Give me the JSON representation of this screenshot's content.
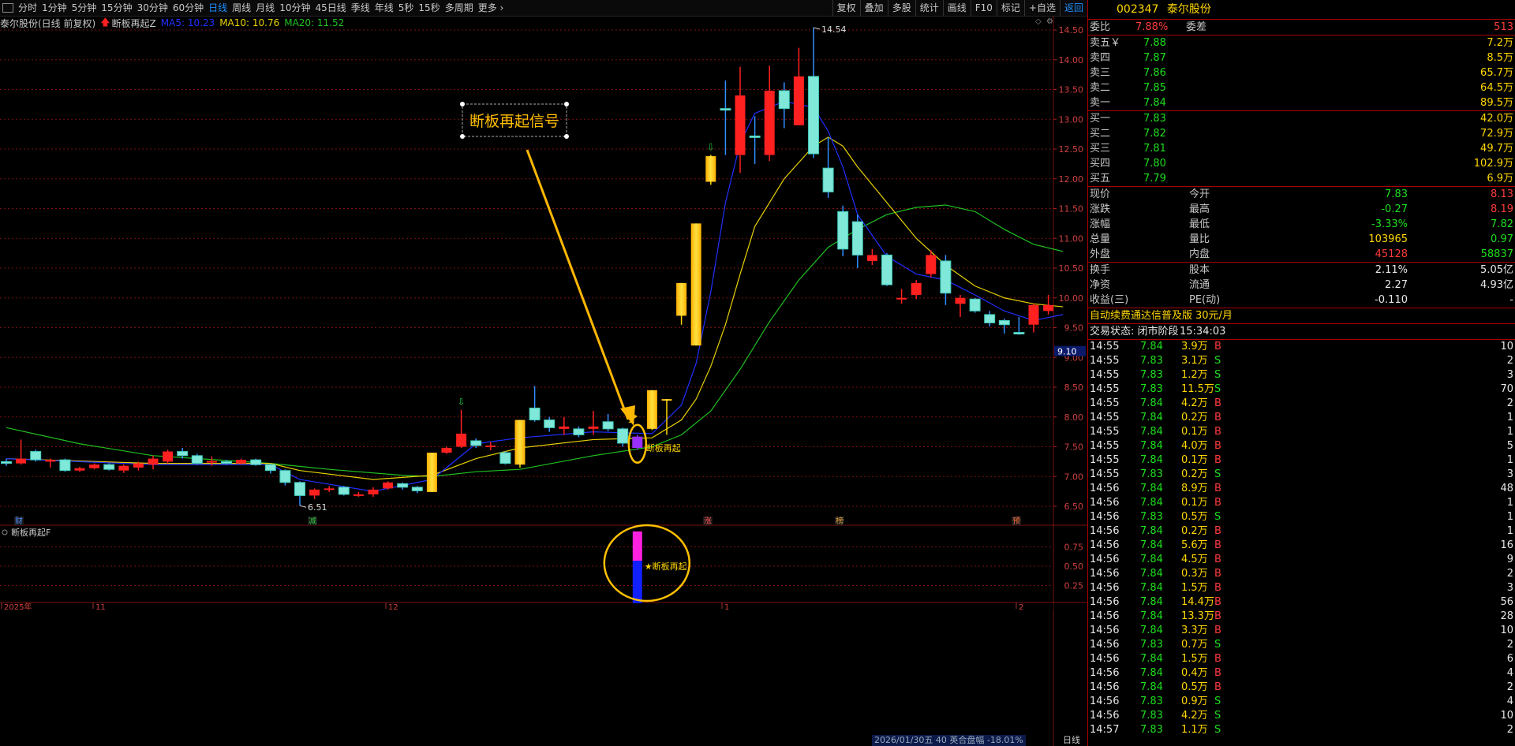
{
  "toolbar": {
    "periods": [
      "分时",
      "1分钟",
      "5分钟",
      "15分钟",
      "30分钟",
      "60分钟",
      "日线",
      "周线",
      "月线",
      "10分钟",
      "45日线",
      "季线",
      "年线",
      "5秒",
      "15秒",
      "多周期",
      "更多 ›"
    ],
    "active_period": "日线",
    "right_buttons": [
      "复权",
      "叠加",
      "多股",
      "统计",
      "画线",
      "F10",
      "标记",
      "+自选",
      "返回"
    ],
    "highlight_button": "返回"
  },
  "info": {
    "stock_label": "泰尔股份(日线 前复权)",
    "indicator_name": "断板再起Z",
    "ma5": "MA5: 10.23",
    "ma10": "MA10: 10.76",
    "ma20": "MA20: 11.52"
  },
  "colors": {
    "up": "#ff2020",
    "down": "#48d8c8",
    "signal": "#ffd700",
    "ma5": "#2030ff",
    "ma10": "#e6d000",
    "ma20": "#20c020",
    "grid": "#7a1010"
  },
  "chart_data": {
    "type": "candlestick",
    "price_axis": {
      "ticks": [
        6.5,
        7.0,
        7.5,
        8.0,
        8.5,
        9.0,
        9.5,
        10.0,
        10.5,
        11.0,
        11.5,
        12.0,
        12.5,
        13.0,
        13.5,
        14.0,
        14.5
      ],
      "range": [
        6.3,
        14.7
      ]
    },
    "annotations": {
      "high": "14.54",
      "low": "6.51",
      "crosshair_price": "9.10",
      "signal_label": "断板再起",
      "box_label": "断板再起信号"
    },
    "date_labels": [
      "2025年",
      "11",
      "12",
      "1",
      "2"
    ],
    "event_markers": [
      "财",
      "减",
      "涨",
      "榜",
      "预"
    ],
    "candles": [
      {
        "o": 7.25,
        "c": 7.22,
        "h": 7.3,
        "l": 7.18,
        "t": "down"
      },
      {
        "o": 7.22,
        "c": 7.3,
        "h": 7.62,
        "l": 7.2,
        "t": "up"
      },
      {
        "o": 7.42,
        "c": 7.28,
        "h": 7.45,
        "l": 7.25,
        "t": "down"
      },
      {
        "o": 7.25,
        "c": 7.28,
        "h": 7.3,
        "l": 7.15,
        "t": "up"
      },
      {
        "o": 7.28,
        "c": 7.1,
        "h": 7.3,
        "l": 7.08,
        "t": "down"
      },
      {
        "o": 7.1,
        "c": 7.14,
        "h": 7.16,
        "l": 7.08,
        "t": "up"
      },
      {
        "o": 7.14,
        "c": 7.2,
        "h": 7.22,
        "l": 7.12,
        "t": "up"
      },
      {
        "o": 7.2,
        "c": 7.12,
        "h": 7.22,
        "l": 7.1,
        "t": "down"
      },
      {
        "o": 7.1,
        "c": 7.18,
        "h": 7.2,
        "l": 7.06,
        "t": "up"
      },
      {
        "o": 7.15,
        "c": 7.22,
        "h": 7.25,
        "l": 7.1,
        "t": "up"
      },
      {
        "o": 7.2,
        "c": 7.3,
        "h": 7.35,
        "l": 7.12,
        "t": "up"
      },
      {
        "o": 7.25,
        "c": 7.42,
        "h": 7.45,
        "l": 7.22,
        "t": "up"
      },
      {
        "o": 7.42,
        "c": 7.35,
        "h": 7.48,
        "l": 7.3,
        "t": "down"
      },
      {
        "o": 7.35,
        "c": 7.22,
        "h": 7.38,
        "l": 7.2,
        "t": "down"
      },
      {
        "o": 7.26,
        "c": 7.26,
        "h": 7.34,
        "l": 7.18,
        "t": "up"
      },
      {
        "o": 7.25,
        "c": 7.22,
        "h": 7.28,
        "l": 7.2,
        "t": "down"
      },
      {
        "o": 7.22,
        "c": 7.28,
        "h": 7.3,
        "l": 7.2,
        "t": "up"
      },
      {
        "o": 7.28,
        "c": 7.2,
        "h": 7.3,
        "l": 7.18,
        "t": "down"
      },
      {
        "o": 7.2,
        "c": 7.1,
        "h": 7.22,
        "l": 7.05,
        "t": "down"
      },
      {
        "o": 7.1,
        "c": 6.9,
        "h": 7.12,
        "l": 6.85,
        "t": "down"
      },
      {
        "o": 6.9,
        "c": 6.68,
        "h": 6.92,
        "l": 6.51,
        "t": "down"
      },
      {
        "o": 6.68,
        "c": 6.78,
        "h": 6.8,
        "l": 6.62,
        "t": "up"
      },
      {
        "o": 6.8,
        "c": 6.8,
        "h": 6.84,
        "l": 6.74,
        "t": "up"
      },
      {
        "o": 6.82,
        "c": 6.7,
        "h": 6.84,
        "l": 6.68,
        "t": "down"
      },
      {
        "o": 6.7,
        "c": 6.7,
        "h": 6.74,
        "l": 6.66,
        "t": "up"
      },
      {
        "o": 6.7,
        "c": 6.78,
        "h": 6.82,
        "l": 6.66,
        "t": "up"
      },
      {
        "o": 6.8,
        "c": 6.9,
        "h": 6.92,
        "l": 6.78,
        "t": "up"
      },
      {
        "o": 6.88,
        "c": 6.82,
        "h": 6.9,
        "l": 6.78,
        "t": "down"
      },
      {
        "o": 6.82,
        "c": 6.76,
        "h": 6.84,
        "l": 6.72,
        "t": "down"
      },
      {
        "o": 6.74,
        "c": 7.4,
        "h": 7.4,
        "l": 6.74,
        "t": "signal"
      },
      {
        "o": 7.4,
        "c": 7.48,
        "h": 7.5,
        "l": 7.38,
        "t": "up"
      },
      {
        "o": 7.5,
        "c": 7.72,
        "h": 8.12,
        "l": 7.48,
        "t": "up"
      },
      {
        "o": 7.6,
        "c": 7.52,
        "h": 7.64,
        "l": 7.48,
        "t": "down"
      },
      {
        "o": 7.52,
        "c": 7.52,
        "h": 7.58,
        "l": 7.44,
        "t": "up"
      },
      {
        "o": 7.4,
        "c": 7.22,
        "h": 7.42,
        "l": 7.2,
        "t": "down"
      },
      {
        "o": 7.2,
        "c": 7.95,
        "h": 7.95,
        "l": 7.15,
        "t": "signal"
      },
      {
        "o": 8.15,
        "c": 7.95,
        "h": 8.52,
        "l": 7.92,
        "t": "down"
      },
      {
        "o": 7.95,
        "c": 7.82,
        "h": 8.0,
        "l": 7.75,
        "t": "down"
      },
      {
        "o": 7.8,
        "c": 7.84,
        "h": 8.0,
        "l": 7.7,
        "t": "up"
      },
      {
        "o": 7.8,
        "c": 7.7,
        "h": 7.84,
        "l": 7.66,
        "t": "down"
      },
      {
        "o": 7.8,
        "c": 7.84,
        "h": 8.1,
        "l": 7.7,
        "t": "up"
      },
      {
        "o": 7.92,
        "c": 7.8,
        "h": 8.05,
        "l": 7.76,
        "t": "down"
      },
      {
        "o": 7.8,
        "c": 7.56,
        "h": 7.82,
        "l": 7.5,
        "t": "down"
      },
      {
        "o": 7.48,
        "c": 7.67,
        "h": 7.7,
        "l": 7.45,
        "t": "purple"
      },
      {
        "o": 7.8,
        "c": 8.45,
        "h": 8.45,
        "l": 7.78,
        "t": "signal"
      },
      {
        "o": 8.3,
        "c": 8.3,
        "h": 8.3,
        "l": 7.7,
        "t": "signal"
      },
      {
        "o": 9.7,
        "c": 10.25,
        "h": 10.25,
        "l": 9.55,
        "t": "signal"
      },
      {
        "o": 9.2,
        "c": 11.25,
        "h": 11.25,
        "l": 9.2,
        "t": "signal"
      },
      {
        "o": 11.95,
        "c": 12.38,
        "h": 12.4,
        "l": 11.9,
        "t": "signal"
      },
      {
        "o": 13.18,
        "c": 13.18,
        "h": 13.65,
        "l": 12.4,
        "t": "down"
      },
      {
        "o": 12.4,
        "c": 13.4,
        "h": 13.88,
        "l": 12.1,
        "t": "up"
      },
      {
        "o": 12.72,
        "c": 12.72,
        "h": 13.05,
        "l": 12.25,
        "t": "down"
      },
      {
        "o": 12.4,
        "c": 13.48,
        "h": 13.9,
        "l": 12.3,
        "t": "up"
      },
      {
        "o": 13.48,
        "c": 13.18,
        "h": 13.62,
        "l": 12.85,
        "t": "down"
      },
      {
        "o": 12.9,
        "c": 13.72,
        "h": 14.2,
        "l": 12.9,
        "t": "up"
      },
      {
        "o": 13.72,
        "c": 12.42,
        "h": 14.54,
        "l": 12.35,
        "t": "down"
      },
      {
        "o": 12.18,
        "c": 11.78,
        "h": 12.7,
        "l": 11.68,
        "t": "down"
      },
      {
        "o": 11.45,
        "c": 10.82,
        "h": 11.55,
        "l": 10.7,
        "t": "down"
      },
      {
        "o": 11.28,
        "c": 10.72,
        "h": 11.4,
        "l": 10.5,
        "t": "down"
      },
      {
        "o": 10.62,
        "c": 10.72,
        "h": 10.82,
        "l": 10.55,
        "t": "up"
      },
      {
        "o": 10.72,
        "c": 10.22,
        "h": 10.75,
        "l": 10.2,
        "t": "down"
      },
      {
        "o": 10.0,
        "c": 10.0,
        "h": 10.15,
        "l": 9.9,
        "t": "up"
      },
      {
        "o": 10.05,
        "c": 10.25,
        "h": 10.3,
        "l": 9.98,
        "t": "up"
      },
      {
        "o": 10.4,
        "c": 10.72,
        "h": 10.8,
        "l": 10.35,
        "t": "up"
      },
      {
        "o": 10.62,
        "c": 10.08,
        "h": 10.72,
        "l": 9.88,
        "t": "down"
      },
      {
        "o": 9.9,
        "c": 10.0,
        "h": 10.05,
        "l": 9.68,
        "t": "up"
      },
      {
        "o": 9.98,
        "c": 9.78,
        "h": 10.0,
        "l": 9.75,
        "t": "down"
      },
      {
        "o": 9.72,
        "c": 9.58,
        "h": 9.78,
        "l": 9.52,
        "t": "down"
      },
      {
        "o": 9.62,
        "c": 9.55,
        "h": 9.65,
        "l": 9.4,
        "t": "down"
      },
      {
        "o": 9.42,
        "c": 9.42,
        "h": 9.68,
        "l": 9.38,
        "t": "down"
      },
      {
        "o": 9.55,
        "c": 9.88,
        "h": 9.9,
        "l": 9.42,
        "t": "up"
      },
      {
        "o": 9.78,
        "c": 9.88,
        "h": 10.05,
        "l": 9.72,
        "t": "up"
      }
    ],
    "ma5": [
      [
        0,
        7.3
      ],
      [
        10,
        7.2
      ],
      [
        18,
        7.2
      ],
      [
        20,
        6.95
      ],
      [
        25,
        6.75
      ],
      [
        29,
        6.95
      ],
      [
        32,
        7.55
      ],
      [
        35,
        7.65
      ],
      [
        40,
        7.75
      ],
      [
        44,
        7.72
      ],
      [
        46,
        8.2
      ],
      [
        47,
        8.9
      ],
      [
        48,
        10.1
      ],
      [
        49,
        11.6
      ],
      [
        50,
        12.6
      ],
      [
        51,
        13.1
      ],
      [
        53,
        13.3
      ],
      [
        55,
        13.2
      ],
      [
        56,
        12.8
      ],
      [
        57,
        12.2
      ],
      [
        58,
        11.4
      ],
      [
        60,
        10.7
      ],
      [
        62,
        10.4
      ],
      [
        64,
        10.3
      ],
      [
        66,
        10.05
      ],
      [
        68,
        9.78
      ],
      [
        70,
        9.62
      ],
      [
        72,
        9.72
      ]
    ],
    "ma10": [
      [
        0,
        7.3
      ],
      [
        10,
        7.22
      ],
      [
        18,
        7.22
      ],
      [
        20,
        7.1
      ],
      [
        25,
        6.95
      ],
      [
        29,
        7.02
      ],
      [
        32,
        7.3
      ],
      [
        35,
        7.48
      ],
      [
        40,
        7.62
      ],
      [
        44,
        7.65
      ],
      [
        46,
        7.95
      ],
      [
        47,
        8.3
      ],
      [
        48,
        8.85
      ],
      [
        49,
        9.55
      ],
      [
        50,
        10.4
      ],
      [
        51,
        11.2
      ],
      [
        53,
        12.0
      ],
      [
        55,
        12.55
      ],
      [
        56,
        12.7
      ],
      [
        57,
        12.55
      ],
      [
        58,
        12.2
      ],
      [
        60,
        11.6
      ],
      [
        62,
        11.0
      ],
      [
        64,
        10.55
      ],
      [
        66,
        10.2
      ],
      [
        68,
        10.0
      ],
      [
        70,
        9.9
      ],
      [
        72,
        9.85
      ]
    ],
    "ma20": [
      [
        0,
        7.82
      ],
      [
        5,
        7.55
      ],
      [
        10,
        7.35
      ],
      [
        18,
        7.22
      ],
      [
        22,
        7.12
      ],
      [
        27,
        7.02
      ],
      [
        29,
        7.0
      ],
      [
        32,
        7.08
      ],
      [
        35,
        7.12
      ],
      [
        40,
        7.35
      ],
      [
        44,
        7.5
      ],
      [
        46,
        7.7
      ],
      [
        48,
        8.1
      ],
      [
        50,
        8.8
      ],
      [
        52,
        9.6
      ],
      [
        54,
        10.3
      ],
      [
        56,
        10.85
      ],
      [
        58,
        11.15
      ],
      [
        60,
        11.4
      ],
      [
        62,
        11.52
      ],
      [
        64,
        11.56
      ],
      [
        66,
        11.45
      ],
      [
        68,
        11.15
      ],
      [
        70,
        10.9
      ],
      [
        72,
        10.78
      ]
    ],
    "sub_indicator": {
      "name": "断板再起F",
      "ticks": [
        0.25,
        0.5,
        0.75
      ],
      "bar_index": 43,
      "label": "★断板再起"
    }
  },
  "panel": {
    "code": "002347",
    "name": "泰尔股份",
    "weibi_label": "委比",
    "weibi": "7.88%",
    "weicha_label": "委差",
    "weicha": "513",
    "sells": [
      {
        "label": "卖五￥",
        "price": "7.88",
        "vol": "7.2万"
      },
      {
        "label": "卖四",
        "price": "7.87",
        "vol": "8.5万"
      },
      {
        "label": "卖三",
        "price": "7.86",
        "vol": "65.7万"
      },
      {
        "label": "卖二",
        "price": "7.85",
        "vol": "64.5万"
      },
      {
        "label": "卖一",
        "price": "7.84",
        "vol": "89.5万"
      }
    ],
    "buys": [
      {
        "label": "买一",
        "price": "7.83",
        "vol": "42.0万"
      },
      {
        "label": "买二",
        "price": "7.82",
        "vol": "72.9万"
      },
      {
        "label": "买三",
        "price": "7.81",
        "vol": "49.7万"
      },
      {
        "label": "买四",
        "price": "7.80",
        "vol": "102.9万"
      },
      {
        "label": "买五",
        "price": "7.79",
        "vol": "6.9万"
      }
    ],
    "quotes": [
      {
        "l1": "现价",
        "v1": "7.83",
        "c1": "grn",
        "l2": "今开",
        "v2": "8.13",
        "c2": "red"
      },
      {
        "l1": "涨跌",
        "v1": "-0.27",
        "c1": "grn",
        "l2": "最高",
        "v2": "8.19",
        "c2": "red"
      },
      {
        "l1": "涨幅",
        "v1": "-3.33%",
        "c1": "grn",
        "l2": "最低",
        "v2": "7.82",
        "c2": "grn"
      },
      {
        "l1": "总量",
        "v1": "103965",
        "c1": "yel",
        "l2": "量比",
        "v2": "0.97",
        "c2": "grn"
      },
      {
        "l1": "外盘",
        "v1": "45128",
        "c1": "red",
        "l2": "内盘",
        "v2": "58837",
        "c2": "grn"
      }
    ],
    "fundamentals": [
      {
        "l1": "换手",
        "v1": "2.11%",
        "l2": "股本",
        "v2": "5.05亿"
      },
      {
        "l1": "净资",
        "v1": "2.27",
        "l2": "流通",
        "v2": "4.93亿"
      },
      {
        "l1": "收益(三)",
        "v1": "-0.110",
        "l2": "PE(动)",
        "v2": "-"
      }
    ],
    "promo": "自动续费通达信普及版",
    "promo_price": "30元/月",
    "status_label": "交易状态: 闭市阶段",
    "status_time": "15:34:03",
    "ticks": [
      {
        "t": "14:55",
        "p": "7.84",
        "v": "3.9万",
        "d": "B",
        "n": "10"
      },
      {
        "t": "14:55",
        "p": "7.83",
        "v": "3.1万",
        "d": "S",
        "n": "2"
      },
      {
        "t": "14:55",
        "p": "7.83",
        "v": "1.2万",
        "d": "S",
        "n": "3"
      },
      {
        "t": "14:55",
        "p": "7.83",
        "v": "11.5万",
        "d": "S",
        "n": "70"
      },
      {
        "t": "14:55",
        "p": "7.84",
        "v": "4.2万",
        "d": "B",
        "n": "2"
      },
      {
        "t": "14:55",
        "p": "7.84",
        "v": "0.2万",
        "d": "B",
        "n": "1"
      },
      {
        "t": "14:55",
        "p": "7.84",
        "v": "0.1万",
        "d": "B",
        "n": "1"
      },
      {
        "t": "14:55",
        "p": "7.84",
        "v": "4.0万",
        "d": "B",
        "n": "5"
      },
      {
        "t": "14:55",
        "p": "7.84",
        "v": "0.1万",
        "d": "B",
        "n": "1"
      },
      {
        "t": "14:55",
        "p": "7.83",
        "v": "0.2万",
        "d": "S",
        "n": "3"
      },
      {
        "t": "14:56",
        "p": "7.84",
        "v": "8.9万",
        "d": "B",
        "n": "48"
      },
      {
        "t": "14:56",
        "p": "7.84",
        "v": "0.1万",
        "d": "B",
        "n": "1"
      },
      {
        "t": "14:56",
        "p": "7.83",
        "v": "0.5万",
        "d": "S",
        "n": "1"
      },
      {
        "t": "14:56",
        "p": "7.84",
        "v": "0.2万",
        "d": "B",
        "n": "1"
      },
      {
        "t": "14:56",
        "p": "7.84",
        "v": "5.6万",
        "d": "B",
        "n": "16"
      },
      {
        "t": "14:56",
        "p": "7.84",
        "v": "4.5万",
        "d": "B",
        "n": "9"
      },
      {
        "t": "14:56",
        "p": "7.84",
        "v": "0.3万",
        "d": "B",
        "n": "2"
      },
      {
        "t": "14:56",
        "p": "7.84",
        "v": "1.5万",
        "d": "B",
        "n": "3"
      },
      {
        "t": "14:56",
        "p": "7.84",
        "v": "14.4万",
        "d": "B",
        "n": "56"
      },
      {
        "t": "14:56",
        "p": "7.84",
        "v": "13.3万",
        "d": "B",
        "n": "28"
      },
      {
        "t": "14:56",
        "p": "7.84",
        "v": "3.3万",
        "d": "B",
        "n": "10"
      },
      {
        "t": "14:56",
        "p": "7.83",
        "v": "0.7万",
        "d": "S",
        "n": "2"
      },
      {
        "t": "14:56",
        "p": "7.84",
        "v": "1.5万",
        "d": "B",
        "n": "6"
      },
      {
        "t": "14:56",
        "p": "7.84",
        "v": "0.4万",
        "d": "B",
        "n": "4"
      },
      {
        "t": "14:56",
        "p": "7.84",
        "v": "0.5万",
        "d": "B",
        "n": "2"
      },
      {
        "t": "14:56",
        "p": "7.83",
        "v": "0.9万",
        "d": "S",
        "n": "4"
      },
      {
        "t": "14:56",
        "p": "7.83",
        "v": "4.2万",
        "d": "S",
        "n": "10"
      },
      {
        "t": "14:57",
        "p": "7.83",
        "v": "1.1万",
        "d": "S",
        "n": "2"
      }
    ]
  },
  "bottom_bar": {
    "date_info": "2026/01/30五 40 英合盘幅 -18.01%",
    "tab": "日线"
  }
}
